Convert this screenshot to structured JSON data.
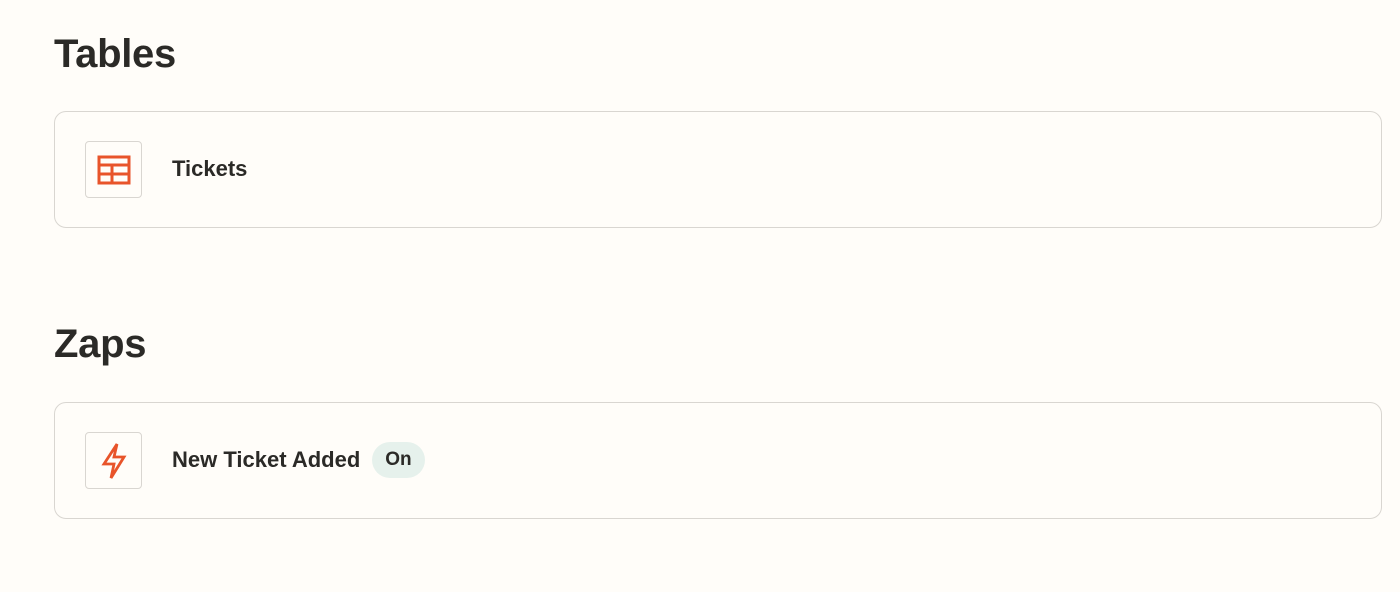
{
  "tables": {
    "heading": "Tables",
    "items": [
      {
        "label": "Tickets",
        "icon": "table-icon"
      }
    ]
  },
  "zaps": {
    "heading": "Zaps",
    "items": [
      {
        "label": "New Ticket Added",
        "status": "On",
        "icon": "lightning-bolt-icon"
      }
    ]
  },
  "colors": {
    "accent": "#ff4f00",
    "icon_stroke": "#e8542a",
    "badge_bg": "#e6f1ec",
    "border": "#d9d6d1",
    "background": "#fffdf9",
    "text": "#2b2a27"
  }
}
